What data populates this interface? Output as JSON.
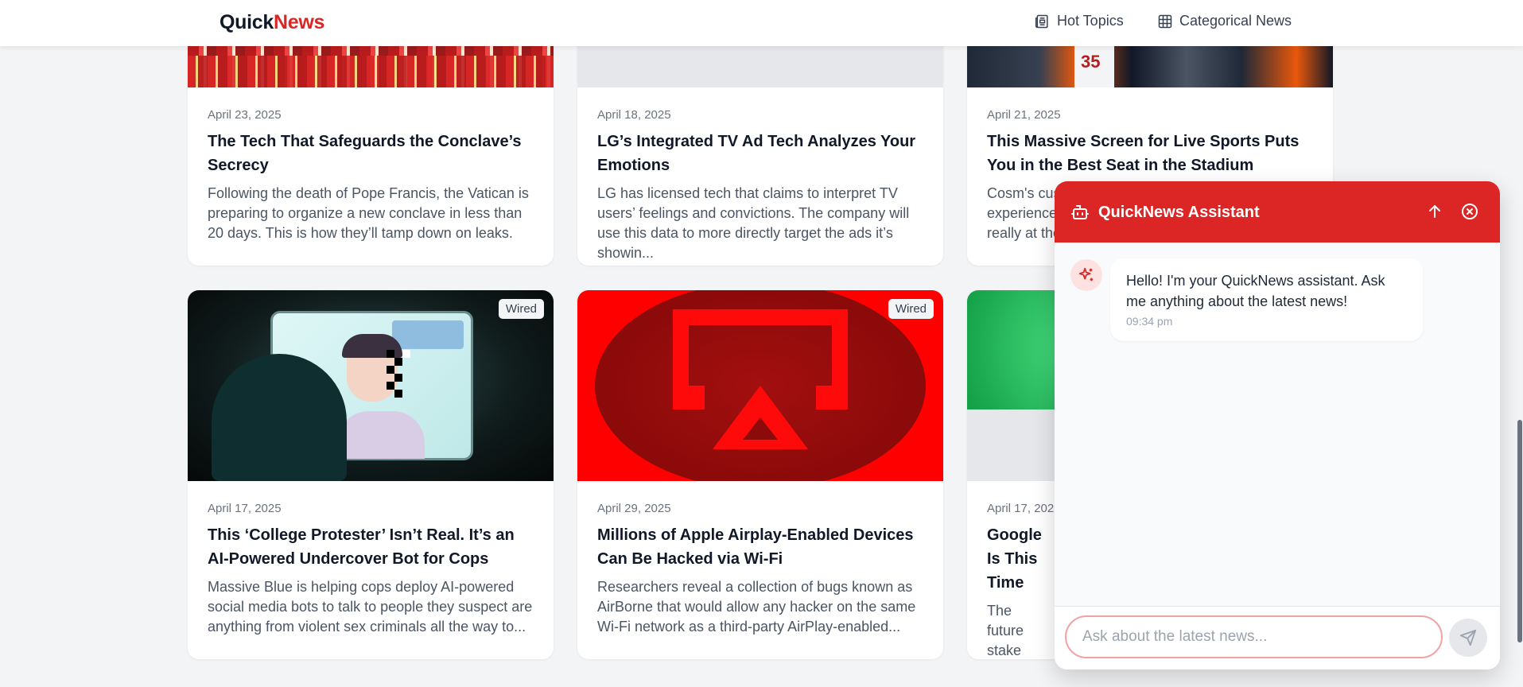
{
  "header": {
    "logo_part1": "Quick",
    "logo_part2": "News",
    "nav": [
      {
        "label": "Hot Topics",
        "icon": "newspaper-icon"
      },
      {
        "label": "Categorical News",
        "icon": "grid-icon"
      }
    ]
  },
  "colors": {
    "brand_red": "#dc2626",
    "page_bg": "#f3f4f6",
    "card_bg": "#ffffff"
  },
  "articles": [
    {
      "date": "April 23, 2025",
      "title": "The Tech That Safeguards the Conclave’s Secrecy",
      "desc": "Following the death of Pope Francis, the Vatican is preparing to organize a new conclave in less than 20 days. This is how they’ll tamp down on leaks."
    },
    {
      "date": "April 18, 2025",
      "title": "LG’s Integrated TV Ad Tech Analyzes Your Emotions",
      "desc": "LG has licensed tech that claims to interpret TV users’ feelings and convictions. The company will use this data to more directly target the ads it’s showin..."
    },
    {
      "date": "April 21, 2025",
      "title": "This Massive Screen for Live Sports Puts You in the Best Seat in the Stadium",
      "desc": "Cosm's cus experience really at the"
    },
    {
      "date": "April 17, 2025",
      "source": "Wired",
      "title": "This ‘College Protester’ Isn’t Real. It’s an AI-Powered Undercover Bot for Cops",
      "desc": "Massive Blue is helping cops deploy AI-powered social media bots to talk to people they suspect are anything from violent sex criminals all the way to..."
    },
    {
      "date": "April 29, 2025",
      "source": "Wired",
      "title": "Millions of Apple Airplay-Enabled Devices Can Be Hacked via Wi-Fi",
      "desc": "Researchers reveal a collection of bugs known as AirBorne that would allow any hacker on the same Wi-Fi network as a third-party AirPlay-enabled..."
    },
    {
      "date": "April 17, 2025",
      "title": "Google Is This Time",
      "desc": "The future stake after illegally mo"
    }
  ],
  "chat": {
    "title": "QuickNews Assistant",
    "message": "Hello! I'm your QuickNews assistant. Ask me anything about the latest news!",
    "time": "09:34 pm",
    "input_placeholder": "Ask about the latest news...",
    "input_value": ""
  }
}
